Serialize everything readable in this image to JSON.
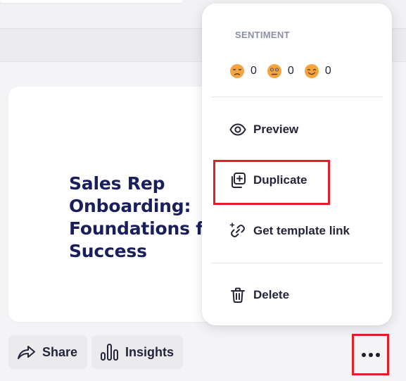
{
  "course_card": {
    "title_lines": [
      "Sales Rep",
      "Onboarding:",
      "Foundations for",
      "Success"
    ]
  },
  "actions": {
    "share_label": "Share",
    "insights_label": "Insights"
  },
  "menu": {
    "sentiment_heading": "SENTIMENT",
    "sentiments": [
      {
        "icon": "sad-face-emoji",
        "count": "0"
      },
      {
        "icon": "neutral-face-emoji",
        "count": "0"
      },
      {
        "icon": "happy-face-emoji",
        "count": "0"
      }
    ],
    "items": [
      {
        "icon": "eye-icon",
        "label": "Preview"
      },
      {
        "icon": "duplicate-icon",
        "label": "Duplicate"
      },
      {
        "icon": "link-icon",
        "label": "Get template link"
      },
      {
        "icon": "trash-icon",
        "label": "Delete"
      }
    ]
  },
  "colors": {
    "title": "#1a1f5c",
    "highlight": "#e01f2a",
    "emoji": "#f2a541"
  }
}
